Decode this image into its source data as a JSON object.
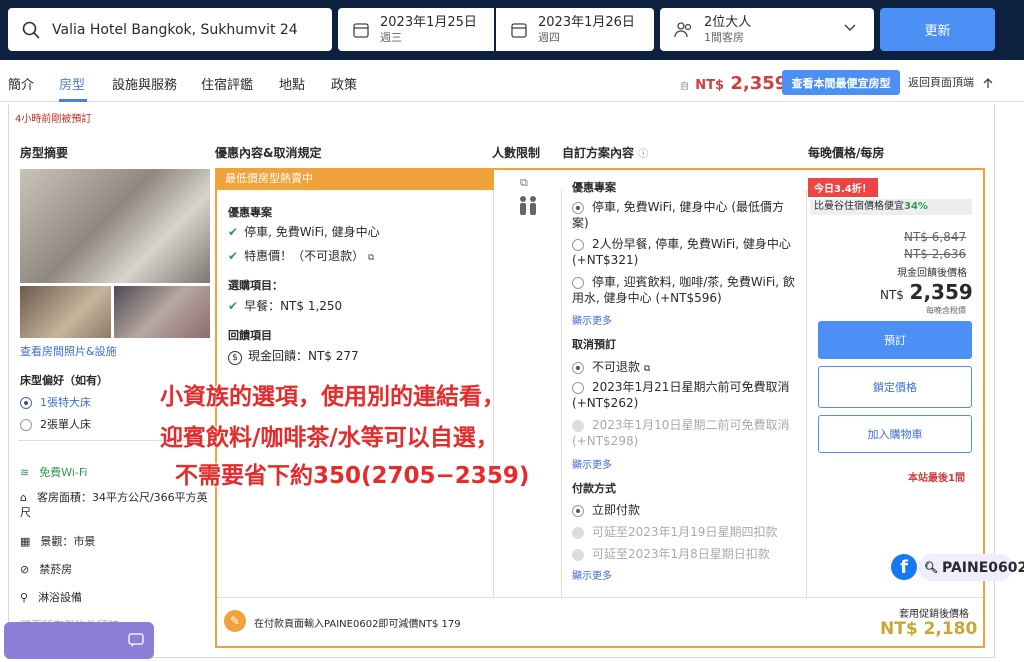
{
  "search": {
    "hotel": "Valia Hotel Bangkok, Sukhumvit 24"
  },
  "dates": [
    {
      "date": "2023年1月25日",
      "weekday": "週三"
    },
    {
      "date": "2023年1月26日",
      "weekday": "週四"
    }
  ],
  "guests": {
    "adults": "2位大人",
    "rooms": "1間客房"
  },
  "update_label": "更新",
  "nav": {
    "tabs": [
      "簡介",
      "房型",
      "設施與服務",
      "住宿評鑑",
      "地點",
      "政策"
    ],
    "price_prefix": "自",
    "currency": "NT$",
    "price": "2,359",
    "best_btn": "查看本間最便宜房型",
    "back_top": "返回頁面頂端"
  },
  "recent_booked": "4小時前剛被預訂",
  "headers": {
    "room": "房型摘要",
    "deal": "優惠內容&取消規定",
    "occupancy": "人數限制",
    "custom": "自訂方案內容",
    "price": "每晚價格/每房"
  },
  "room": {
    "photos_link": "查看房間照片&設施",
    "bed_pref": "床型偏好（如有）",
    "bed_options": [
      "1張特大床",
      "2張單人床"
    ],
    "features": [
      "免費Wi-Fi",
      "客房面積：34平方公尺/366平方英尺",
      "景觀：市景",
      "禁菸房",
      "淋浴設備",
      "可要所有與物件留時"
    ]
  },
  "deal": {
    "header": "最低價房型熱賣中",
    "section1": "優惠專案",
    "items1": [
      "停車, 免費WiFi, 健身中心",
      "特惠價！（不可退款）"
    ],
    "section2": "選購項目：",
    "items2": [
      "早餐：NT$ 1,250"
    ],
    "section3": "回饋項目",
    "items3": [
      "現金回饋：NT$ 277"
    ]
  },
  "custom": {
    "section1": "優惠專案",
    "opts1": [
      "停車, 免費WiFi, 健身中心 (最低價方案)",
      "2人份早餐, 停車, 免費WiFi, 健身中心 (+NT$321)",
      "停車, 迎賓飲料, 咖啡/茶, 免費WiFi, 飲用水, 健身中心 (+NT$596)"
    ],
    "more": "顯示更多",
    "section2": "取消預訂",
    "opts2": [
      "不可退款",
      "2023年1月21日星期六前可免費取消 (+NT$262)",
      "2023年1月10日星期二前可免費取消 (+NT$298)"
    ],
    "section3": "付款方式",
    "opts3": [
      "立即付款",
      "可延至2023年1月19日星期四扣款",
      "可延至2023年1月8日星期日扣款"
    ]
  },
  "price": {
    "badge": "今日3.4折！",
    "compare": "比曼谷住宿價格便宜",
    "compare_pct": "34%",
    "old1": "NT$ 6,847",
    "old2": "NT$ 2,636",
    "after_label": "現金回饋後價格",
    "currency": "NT$",
    "value": "2,359",
    "tax_note": "每晚含稅價",
    "book": "預訂",
    "lock": "鎖定價格",
    "cart": "加入購物車",
    "last": "本站最後1間"
  },
  "promo": {
    "text": "在付款頁面輸入PAINE0602即可減價NT$ 179",
    "label": "套用促銷後價格",
    "value": "NT$ 2,180"
  },
  "annotation": [
    "小資族的選項，使用別的連結看，",
    "迎賓飲料/咖啡茶/水等可以自選，",
    "不需要省下約350(2705−2359)"
  ],
  "watermark": "PAINE0602"
}
